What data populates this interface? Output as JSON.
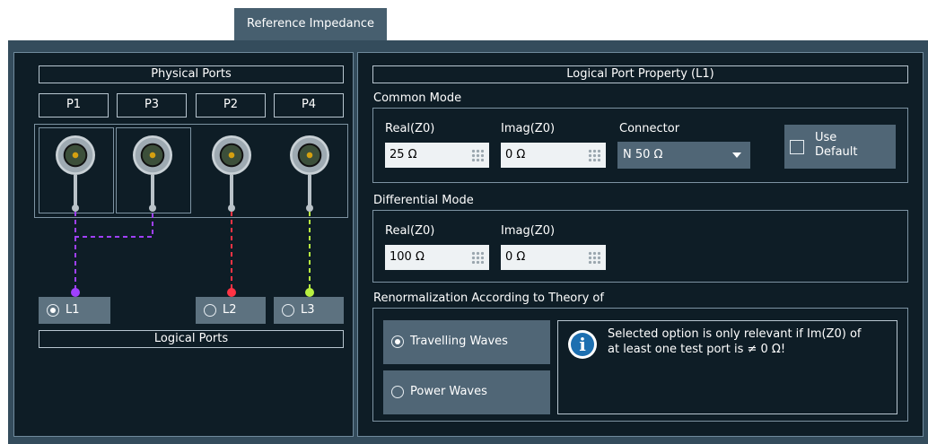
{
  "tab": {
    "label": "Reference Impedance"
  },
  "left": {
    "physical_header": "Physical Ports",
    "physical_ports": [
      "P1",
      "P3",
      "P2",
      "P4"
    ],
    "logical_ports": [
      {
        "label": "L1",
        "selected": true,
        "color": "#a040ff"
      },
      {
        "label": "L2",
        "selected": false,
        "color": "#ff3344"
      },
      {
        "label": "L3",
        "selected": false,
        "color": "#b8f040"
      }
    ],
    "logical_header": "Logical Ports"
  },
  "right": {
    "title": "Logical Port Property (L1)",
    "common_mode": {
      "title": "Common Mode",
      "real_label": "Real(Z0)",
      "real_value": "25 Ω",
      "imag_label": "Imag(Z0)",
      "imag_value": "0 Ω",
      "connector_label": "Connector",
      "connector_value": "N 50 Ω",
      "use_default_label_1": "Use",
      "use_default_label_2": "Default",
      "use_default_checked": false
    },
    "differential_mode": {
      "title": "Differential Mode",
      "real_label": "Real(Z0)",
      "real_value": "100 Ω",
      "imag_label": "Imag(Z0)",
      "imag_value": "0 Ω"
    },
    "renormalization": {
      "title": "Renormalization According to Theory of",
      "options": [
        {
          "label": "Travelling Waves",
          "selected": true
        },
        {
          "label": "Power Waves",
          "selected": false
        }
      ],
      "info_line_1": "Selected option is only relevant if Im(Z0) of",
      "info_line_2": "at least one test port is ≠ 0 Ω!"
    }
  },
  "icons": {
    "info": "info-icon",
    "keypad": "keypad-icon",
    "dropdown": "chevron-down-icon",
    "connector": "connector-icon"
  }
}
